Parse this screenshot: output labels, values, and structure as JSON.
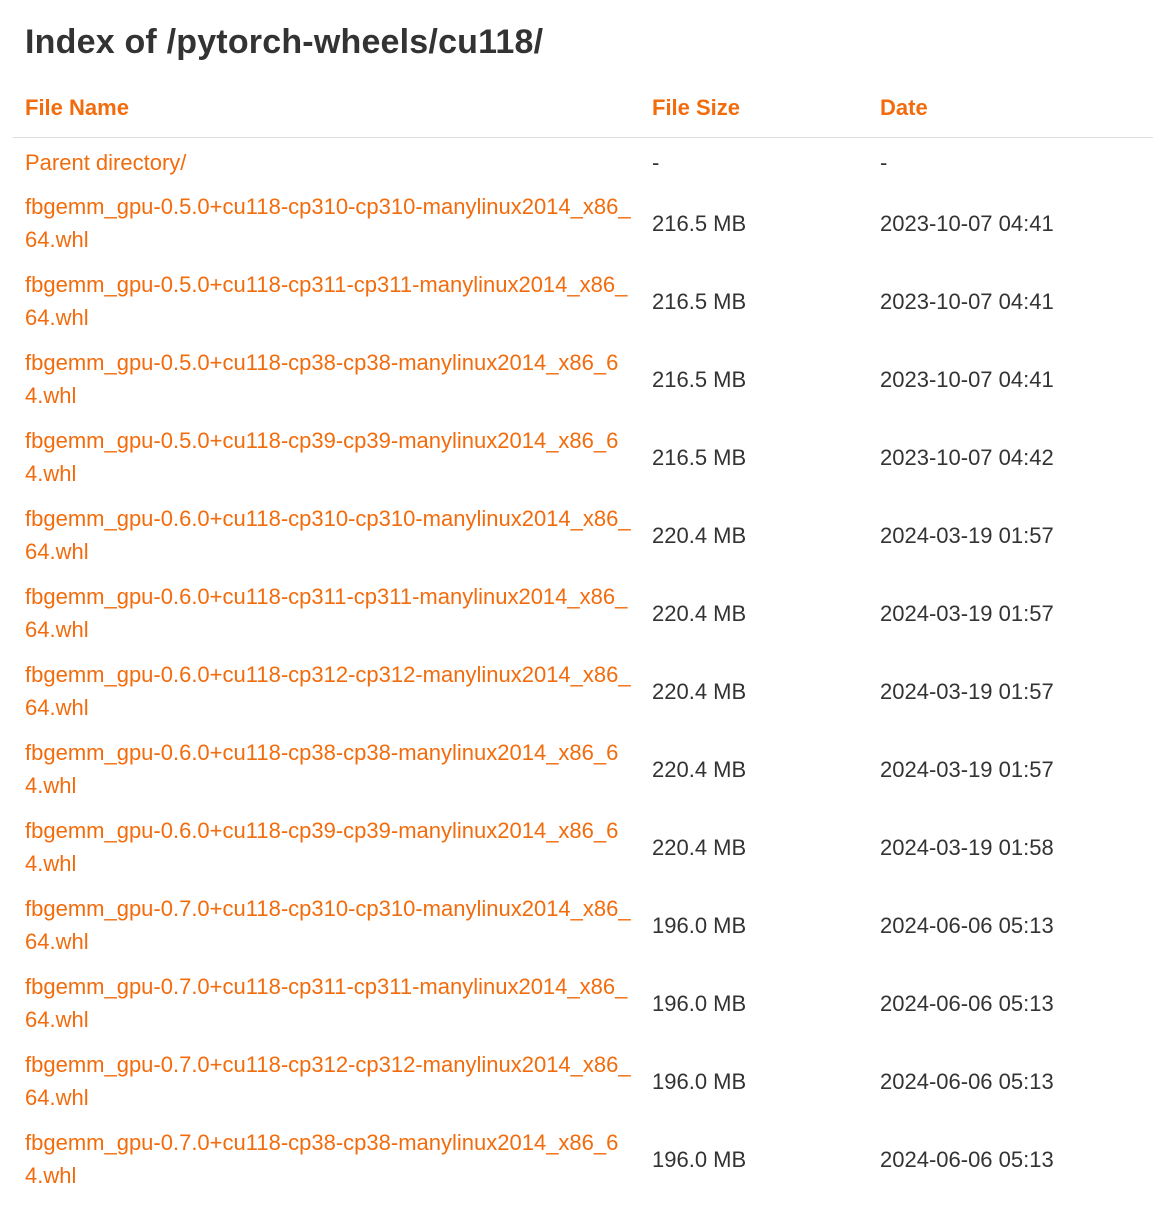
{
  "page": {
    "title": "Index of /pytorch-wheels/cu118/"
  },
  "table": {
    "headers": {
      "name": "File Name",
      "size": "File Size",
      "date": "Date"
    },
    "parent": {
      "name": "Parent directory/",
      "size": "-",
      "date": "-"
    },
    "rows": [
      {
        "name": "fbgemm_gpu-0.5.0+cu118-cp310-cp310-manylinux2014_x86_64.whl",
        "size": "216.5 MB",
        "date": "2023-10-07 04:41"
      },
      {
        "name": "fbgemm_gpu-0.5.0+cu118-cp311-cp311-manylinux2014_x86_64.whl",
        "size": "216.5 MB",
        "date": "2023-10-07 04:41"
      },
      {
        "name": "fbgemm_gpu-0.5.0+cu118-cp38-cp38-manylinux2014_x86_64.whl",
        "size": "216.5 MB",
        "date": "2023-10-07 04:41"
      },
      {
        "name": "fbgemm_gpu-0.5.0+cu118-cp39-cp39-manylinux2014_x86_64.whl",
        "size": "216.5 MB",
        "date": "2023-10-07 04:42"
      },
      {
        "name": "fbgemm_gpu-0.6.0+cu118-cp310-cp310-manylinux2014_x86_64.whl",
        "size": "220.4 MB",
        "date": "2024-03-19 01:57"
      },
      {
        "name": "fbgemm_gpu-0.6.0+cu118-cp311-cp311-manylinux2014_x86_64.whl",
        "size": "220.4 MB",
        "date": "2024-03-19 01:57"
      },
      {
        "name": "fbgemm_gpu-0.6.0+cu118-cp312-cp312-manylinux2014_x86_64.whl",
        "size": "220.4 MB",
        "date": "2024-03-19 01:57"
      },
      {
        "name": "fbgemm_gpu-0.6.0+cu118-cp38-cp38-manylinux2014_x86_64.whl",
        "size": "220.4 MB",
        "date": "2024-03-19 01:57"
      },
      {
        "name": "fbgemm_gpu-0.6.0+cu118-cp39-cp39-manylinux2014_x86_64.whl",
        "size": "220.4 MB",
        "date": "2024-03-19 01:58"
      },
      {
        "name": "fbgemm_gpu-0.7.0+cu118-cp310-cp310-manylinux2014_x86_64.whl",
        "size": "196.0 MB",
        "date": "2024-06-06 05:13"
      },
      {
        "name": "fbgemm_gpu-0.7.0+cu118-cp311-cp311-manylinux2014_x86_64.whl",
        "size": "196.0 MB",
        "date": "2024-06-06 05:13"
      },
      {
        "name": "fbgemm_gpu-0.7.0+cu118-cp312-cp312-manylinux2014_x86_64.whl",
        "size": "196.0 MB",
        "date": "2024-06-06 05:13"
      },
      {
        "name": "fbgemm_gpu-0.7.0+cu118-cp38-cp38-manylinux2014_x86_64.whl",
        "size": "196.0 MB",
        "date": "2024-06-06 05:13"
      }
    ]
  },
  "colors": {
    "link": "#f26c0d",
    "text": "#333333",
    "divider": "#dddddd"
  }
}
